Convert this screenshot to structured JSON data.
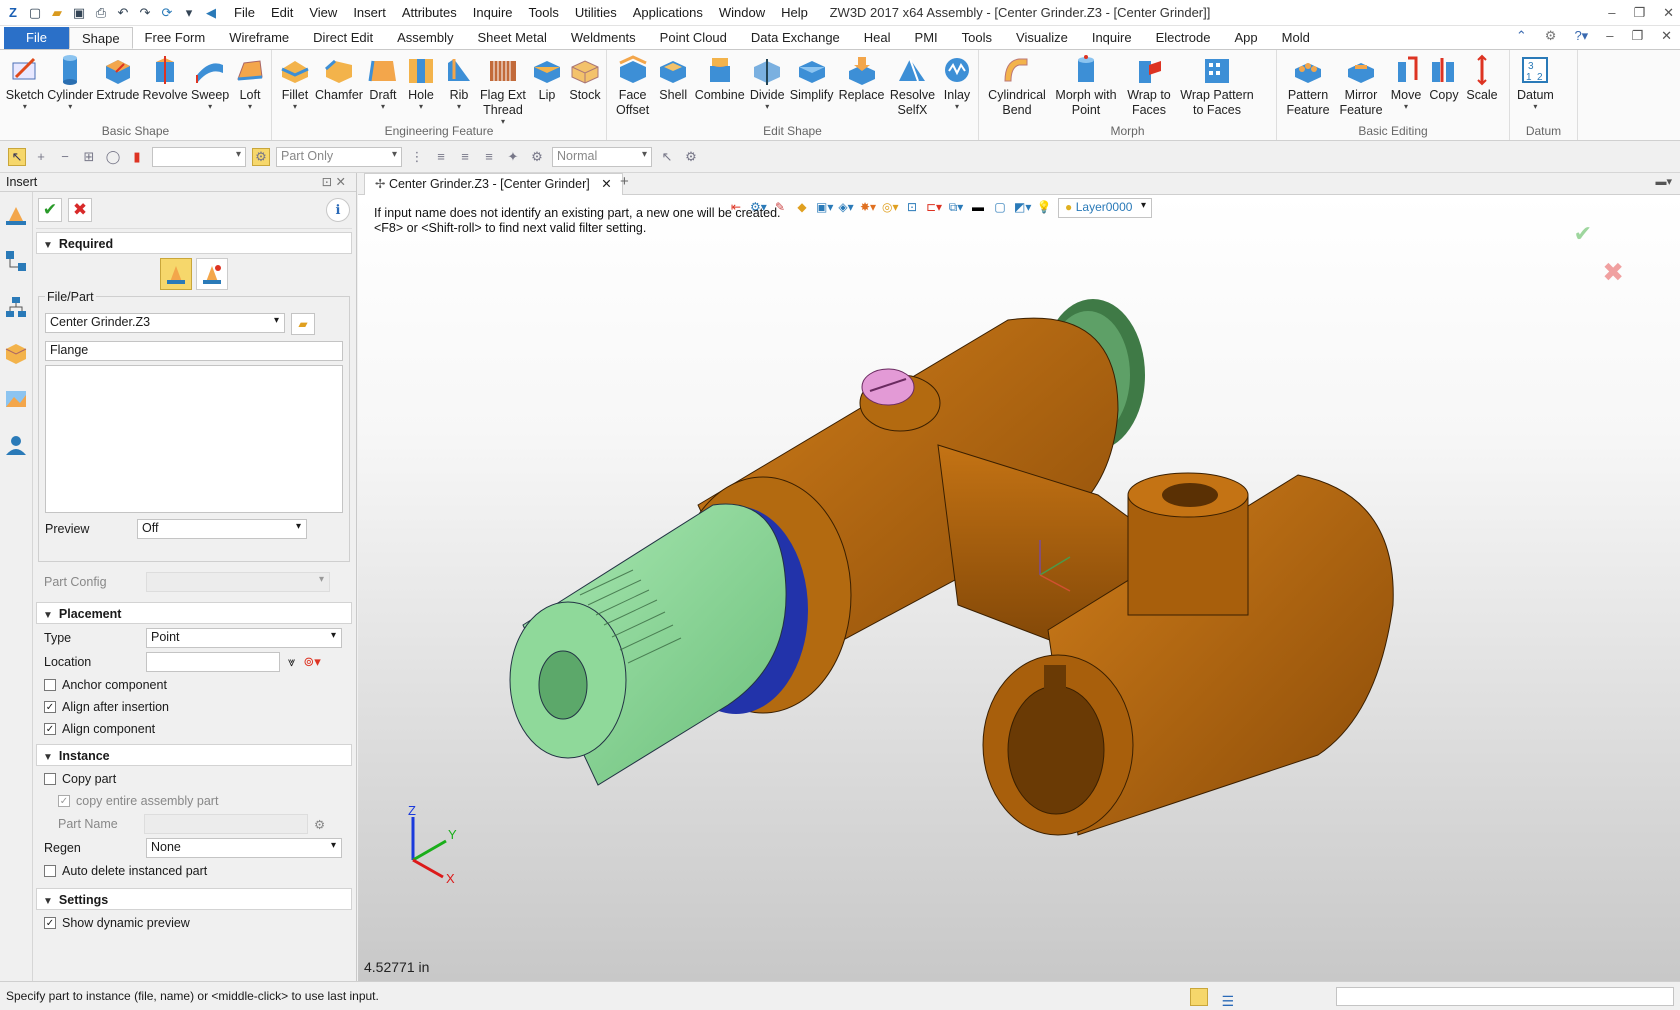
{
  "app": {
    "title": "ZW3D 2017  x64        Assembly - [Center Grinder.Z3 - [Center Grinder]]"
  },
  "menu": [
    "File",
    "Edit",
    "View",
    "Insert",
    "Attributes",
    "Inquire",
    "Tools",
    "Utilities",
    "Applications",
    "Window",
    "Help"
  ],
  "tabs": [
    "File",
    "Shape",
    "Free Form",
    "Wireframe",
    "Direct Edit",
    "Assembly",
    "Sheet Metal",
    "Weldments",
    "Point Cloud",
    "Data Exchange",
    "Heal",
    "PMI",
    "Tools",
    "Visualize",
    "Inquire",
    "Electrode",
    "App",
    "Mold"
  ],
  "ribbon": {
    "basic_shape": {
      "label": "Basic Shape",
      "items": [
        "Sketch",
        "Cylinder",
        "Extrude",
        "Revolve",
        "Sweep",
        "Loft"
      ]
    },
    "engineering_feature": {
      "label": "Engineering Feature",
      "items": [
        "Fillet",
        "Chamfer",
        "Draft",
        "Hole",
        "Rib",
        "Flag Ext Thread",
        "Lip",
        "Stock"
      ]
    },
    "edit_shape": {
      "label": "Edit Shape",
      "items": [
        "Face Offset",
        "Shell",
        "Combine",
        "Divide",
        "Simplify",
        "Replace",
        "Resolve SelfX",
        "Inlay"
      ]
    },
    "morph": {
      "label": "Morph",
      "items": [
        "Cylindrical Bend",
        "Morph with Point",
        "Wrap to Faces",
        "Wrap Pattern to Faces"
      ]
    },
    "basic_editing": {
      "label": "Basic Editing",
      "items": [
        "Pattern Feature",
        "Mirror Feature",
        "Move",
        "Copy",
        "Scale"
      ]
    },
    "datum": {
      "label": "Datum",
      "items": [
        "Datum"
      ]
    }
  },
  "toolbar2": {
    "filter_value": "Part Only",
    "mode_value": "Normal"
  },
  "panel": {
    "title": "Insert",
    "required": {
      "header": "Required",
      "file_part_label": "File/Part",
      "file_value": "Center Grinder.Z3",
      "name_value": "Flange",
      "preview_label": "Preview",
      "preview_value": "Off",
      "part_config_label": "Part Config"
    },
    "placement": {
      "header": "Placement",
      "type_label": "Type",
      "type_value": "Point",
      "location_label": "Location",
      "anchor_component": "Anchor component",
      "align_after_insertion": "Align after insertion",
      "align_component": "Align component"
    },
    "instance": {
      "header": "Instance",
      "copy_part": "Copy part",
      "copy_entire": "copy entire assembly part",
      "part_name_label": "Part  Name",
      "regen_label": "Regen",
      "regen_value": "None",
      "auto_delete": "Auto delete instanced part"
    },
    "settings": {
      "header": "Settings",
      "show_dynamic_preview": "Show dynamic preview"
    }
  },
  "document": {
    "tab_label": "Center Grinder.Z3 - [Center Grinder]",
    "layer_value": "Layer0000",
    "hint_line1": "If input name does not identify an existing part, a new one will be created.",
    "hint_line2": "<F8> or <Shift-roll> to find next valid filter setting.",
    "readout": "4.52771 in",
    "triad": {
      "x": "X",
      "y": "Y",
      "z": "Z"
    }
  },
  "status": {
    "prompt": "Specify part to instance (file, name) or <middle-click> to use last input."
  },
  "colors": {
    "part_bronze": "#b8680e",
    "part_green": "#8fd99a",
    "part_pink": "#e39ad6",
    "accent_blue": "#2b70c8"
  }
}
